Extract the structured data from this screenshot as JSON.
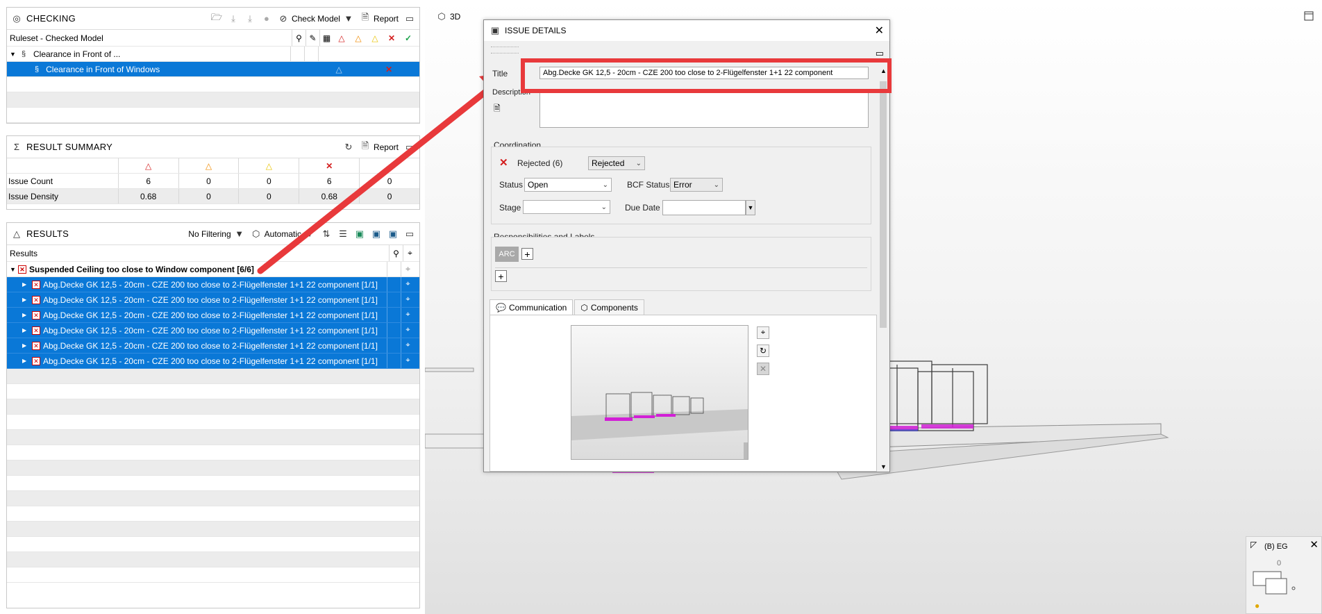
{
  "checking": {
    "title": "CHECKING",
    "check_model_label": "Check Model",
    "report_label": "Report",
    "columns_label": "Ruleset - Checked Model",
    "group_row": "Clearance in Front of ...",
    "selected_row": "Clearance in Front of Windows"
  },
  "summary": {
    "title": "RESULT SUMMARY",
    "report_label": "Report",
    "rows": [
      {
        "label": "Issue Count",
        "vals": [
          "6",
          "0",
          "0",
          "6",
          "0"
        ]
      },
      {
        "label": "Issue Density",
        "vals": [
          "0.68",
          "0",
          "0",
          "0.68",
          "0"
        ]
      }
    ]
  },
  "results": {
    "title": "RESULTS",
    "filter_label": "No Filtering",
    "mode_label": "Automatic",
    "header_label": "Results",
    "group_label": "Suspended Ceiling too close to Window component [6/6]",
    "items": [
      "Abg.Decke GK 12,5 - 20cm - CZE 200 too close to 2-Flügelfenster 1+1 22 component [1/1]",
      "Abg.Decke GK 12,5 - 20cm - CZE 200 too close to 2-Flügelfenster 1+1 22 component [1/1]",
      "Abg.Decke GK 12,5 - 20cm - CZE 200 too close to 2-Flügelfenster 1+1 22 component [1/1]",
      "Abg.Decke GK 12,5 - 20cm - CZE 200 too close to 2-Flügelfenster 1+1 22 component [1/1]",
      "Abg.Decke GK 12,5 - 20cm - CZE 200 too close to 2-Flügelfenster 1+1 22 component [1/1]",
      "Abg.Decke GK 12,5 - 20cm - CZE 200 too close to 2-Flügelfenster 1+1 22 component [1/1]"
    ]
  },
  "view3d": {
    "tab_label": "3D"
  },
  "dialog": {
    "title": "ISSUE DETAILS",
    "title_label": "Title",
    "title_value": "Abg.Decke GK 12,5 - 20cm - CZE 200 too close to 2-Flügelfenster 1+1 22 component",
    "description_label": "Description",
    "coordination_label": "Coordination",
    "rejected_text": "Rejected (6)",
    "rejected_select": "Rejected",
    "status_label": "Status",
    "status_value": "Open",
    "bcf_status_label": "BCF Status",
    "bcf_status_value": "Error",
    "stage_label": "Stage",
    "stage_value": "",
    "due_date_label": "Due Date",
    "due_date_value": "",
    "responsibilities_label": "Responsibilities and Labels",
    "arc_tag": "ARC",
    "tab_communication": "Communication",
    "tab_components": "Components"
  },
  "minimap": {
    "label": "(B) EG",
    "value": "0"
  },
  "colors": {
    "selection": "#0a78d7",
    "arrow": "#e8393b",
    "magenta": "#d21fd6"
  }
}
